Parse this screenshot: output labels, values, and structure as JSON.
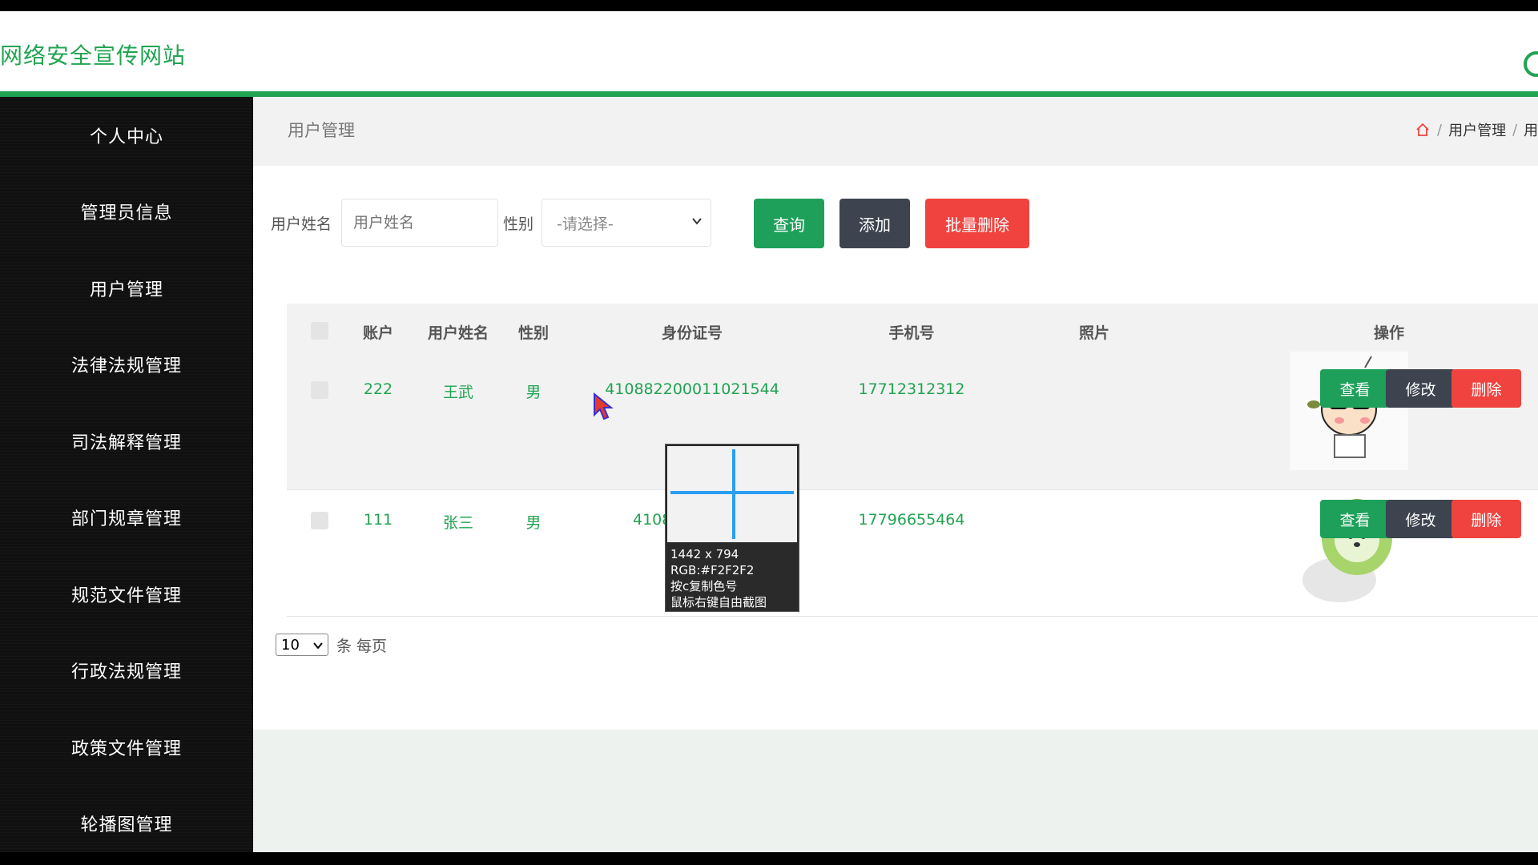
{
  "header": {
    "title": "网络安全宣传网站"
  },
  "sidebar": {
    "items": [
      {
        "label": "个人中心"
      },
      {
        "label": "管理员信息"
      },
      {
        "label": "用户管理"
      },
      {
        "label": "法律法规管理"
      },
      {
        "label": "司法解释管理"
      },
      {
        "label": "部门规章管理"
      },
      {
        "label": "规范文件管理"
      },
      {
        "label": "行政法规管理"
      },
      {
        "label": "政策文件管理"
      },
      {
        "label": "轮播图管理"
      }
    ]
  },
  "breadcrumb": {
    "page_title": "用户管理",
    "items": [
      "用户管理",
      "用"
    ],
    "separator": "/"
  },
  "filters": {
    "name_label": "用户姓名",
    "name_placeholder": "用户姓名",
    "gender_label": "性别",
    "gender_selected": "-请选择-",
    "search_label": "查询",
    "add_label": "添加",
    "batch_delete_label": "批量删除"
  },
  "table": {
    "headers": {
      "account": "账户",
      "name": "用户姓名",
      "gender": "性别",
      "id_number": "身份证号",
      "phone": "手机号",
      "photo": "照片",
      "actions": "操作"
    },
    "rows": [
      {
        "account": "222",
        "name": "王武",
        "gender": "男",
        "id_number": "410882200011021544",
        "phone": "17712312312",
        "photo": "cartoon-boy-photo"
      },
      {
        "account": "111",
        "name": "张三",
        "gender": "男",
        "id_number": "410882",
        "phone": "17796655464",
        "photo": "cabbage-dog-photo"
      }
    ],
    "row_actions": {
      "view": "查看",
      "edit": "修改",
      "delete": "删除"
    }
  },
  "pager": {
    "page_size": "10",
    "per_page_text": "条 每页"
  },
  "color_picker": {
    "size": "1442 x 794",
    "rgb": "RGB:#F2F2F2",
    "hint1": "按c复制色号",
    "hint2": "鼠标右键自由截图"
  },
  "colors": {
    "accent": "#21a352",
    "danger": "#f0433f",
    "dark": "#3d4450",
    "sidebar": "#101010"
  }
}
